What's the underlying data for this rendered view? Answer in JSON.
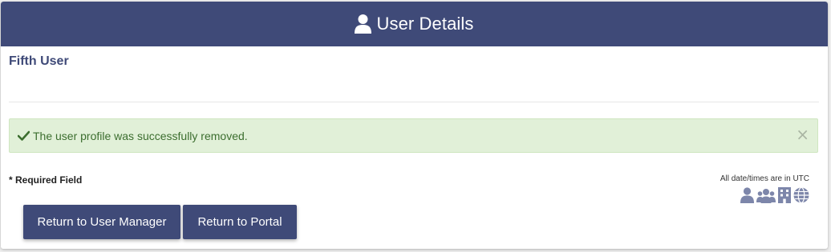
{
  "header": {
    "title": "User Details",
    "icon": "user-icon",
    "bg_color": "#3f4a78"
  },
  "user": {
    "name": "Fifth User"
  },
  "alert": {
    "message": "The user profile was successfully removed.",
    "icon": "check-icon",
    "close_label": "×",
    "bg_color": "#e1f0d8",
    "text_color": "#3c6e2f"
  },
  "form": {
    "required_note": "* Required Field",
    "utc_note": "All date/times are in UTC",
    "legend_icons": [
      "user-icon",
      "users-group-icon",
      "building-icon",
      "globe-icon"
    ]
  },
  "buttons": {
    "return_user_manager": "Return to User Manager",
    "return_portal": "Return to Portal"
  },
  "colors": {
    "accent": "#3f4a78",
    "icon_muted": "#7d86aa"
  }
}
